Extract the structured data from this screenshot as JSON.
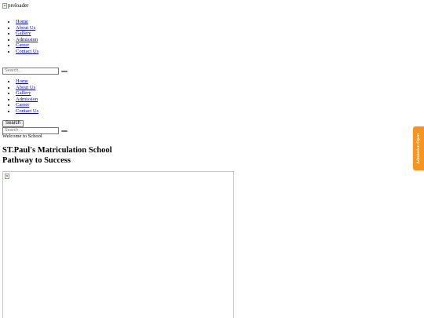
{
  "preloader": {
    "alt_text": "preloader"
  },
  "nav_primary": {
    "items": [
      "Home",
      "About Us",
      "Gallery",
      "Admission",
      "Career",
      "Contact Us"
    ]
  },
  "search_primary": {
    "placeholder": "Search..."
  },
  "nav_secondary": {
    "items": [
      "Home",
      "About Us",
      "Gallery",
      "Admission",
      "Career",
      "Contact Us"
    ]
  },
  "search_button": {
    "label": "Search"
  },
  "search_secondary": {
    "placeholder": "Search ..."
  },
  "hero": {
    "welcome": "Welcome to School",
    "title_line1": "ST.Paul's Matriculation School",
    "title_line2": "Pathway to Success"
  },
  "side_tab": {
    "label": "Admission Open",
    "color": "#f7941d"
  }
}
